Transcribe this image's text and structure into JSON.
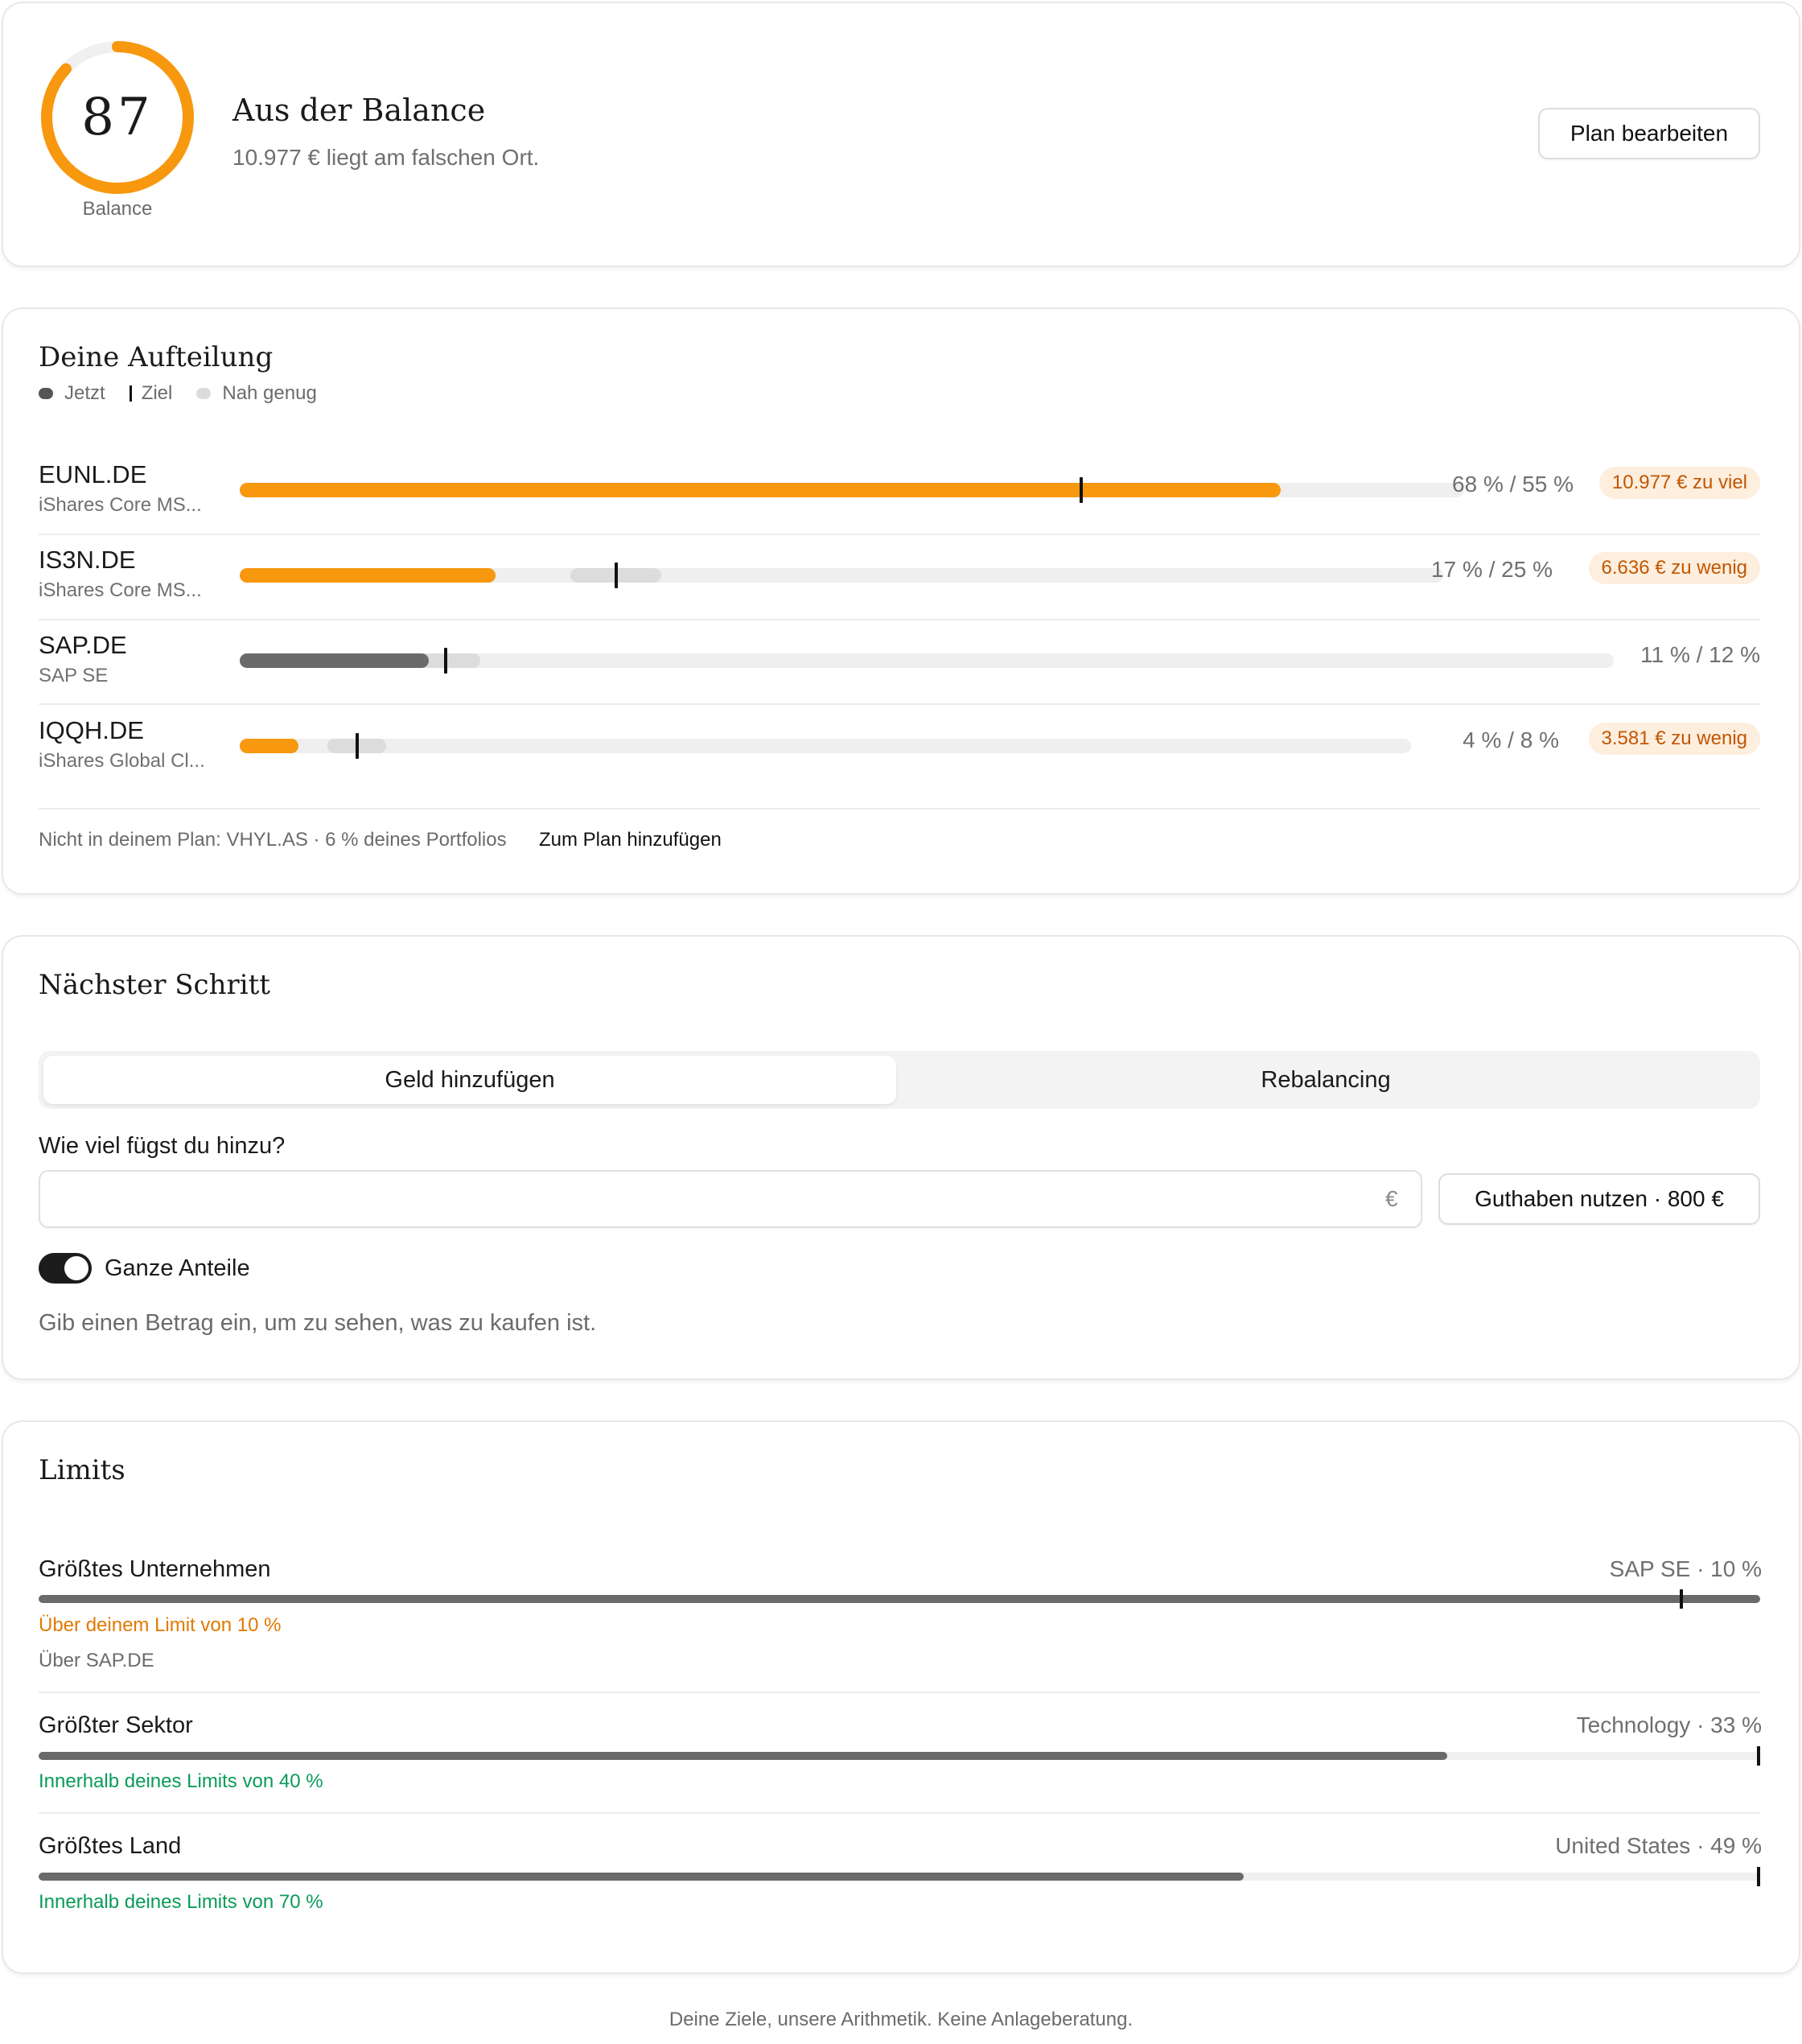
{
  "header": {
    "score": "87",
    "score_fraction": 0.87,
    "score_label": "Balance",
    "title": "Aus der Balance",
    "subtitle": "10.977 € liegt am falschen Ort.",
    "edit_plan_label": "Plan bearbeiten"
  },
  "colors": {
    "accent": "#f7980f",
    "neutral_bar": "#6a6a6a",
    "badge_bg": "#fdeede",
    "badge_text": "#c25600",
    "over_limit": "#e07a00",
    "within_limit": "#0a9b58"
  },
  "allocation": {
    "title": "Deine Aufteilung",
    "legend": {
      "now": "Jetzt",
      "target": "Ziel",
      "close_enough": "Nah genug"
    },
    "rows": [
      {
        "ticker": "EUNL.DE",
        "name": "iShares Core MS...",
        "pct_text": "68 % / 55 %",
        "badge": "10.977 € zu viel",
        "current": 68,
        "target": 55,
        "band": [
          52,
          58
        ],
        "status": "over"
      },
      {
        "ticker": "IS3N.DE",
        "name": "iShares Core MS...",
        "pct_text": "17 % / 25 %",
        "badge": "6.636 € zu wenig",
        "current": 17,
        "target": 25,
        "band": [
          22,
          28
        ],
        "status": "under"
      },
      {
        "ticker": "SAP.DE",
        "name": "SAP SE",
        "pct_text": "11 % / 12 %",
        "badge": "",
        "current": 11,
        "target": 12,
        "band": [
          10,
          14
        ],
        "status": "ok"
      },
      {
        "ticker": "IQQH.DE",
        "name": "iShares Global Cl...",
        "pct_text": "4 % / 8 %",
        "badge": "3.581 € zu wenig",
        "current": 4,
        "target": 8,
        "band": [
          6,
          10
        ],
        "status": "under"
      }
    ],
    "not_in_plan": "Nicht in deinem Plan: VHYL.AS · 6 % deines Portfolios",
    "add_to_plan": "Zum Plan hinzufügen"
  },
  "next_step": {
    "title": "Nächster Schritt",
    "tabs": [
      "Geld hinzufügen",
      "Rebalancing"
    ],
    "active_tab": "Geld hinzufügen",
    "amount_label": "Wie viel fügst du hinzu?",
    "amount_value": "",
    "currency": "€",
    "use_balance_label": "Guthaben nutzen · 800 €",
    "whole_shares_label": "Ganze Anteile",
    "whole_shares_on": true,
    "hint": "Gib einen Betrag ein, um zu sehen, was zu kaufen ist."
  },
  "limits": {
    "title": "Limits",
    "items": [
      {
        "label": "Größtes Unternehmen",
        "value": "SAP SE · 10 %",
        "status": "Über deinem Limit von 10 %",
        "sub": "Über SAP.DE",
        "fill": 1.0,
        "marker": 0.955,
        "over": true
      },
      {
        "label": "Größter Sektor",
        "value": "Technology · 33 %",
        "status": "Innerhalb deines Limits von 40 %",
        "sub": "",
        "fill": 0.818,
        "marker": 1.0,
        "over": false
      },
      {
        "label": "Größtes Land",
        "value": "United States · 49 %",
        "status": "Innerhalb deines Limits von 70 %",
        "sub": "",
        "fill": 0.7,
        "marker": 1.0,
        "over": false
      }
    ]
  },
  "footer": "Deine Ziele, unsere Arithmetik. Keine Anlageberatung."
}
